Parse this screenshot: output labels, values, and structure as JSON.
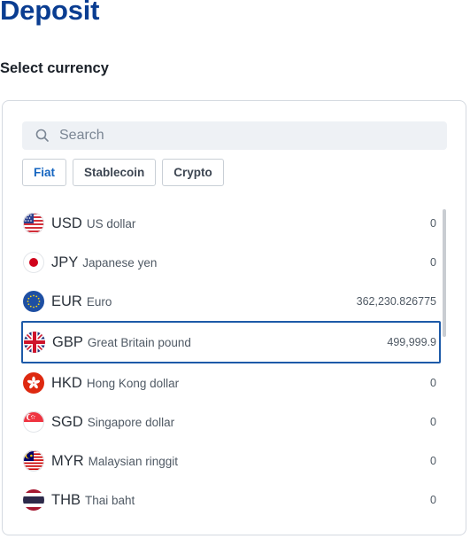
{
  "page": {
    "title": "Deposit",
    "subtitle": "Select currency"
  },
  "search": {
    "placeholder": "Search",
    "value": "",
    "icon": "search-icon"
  },
  "tabs": [
    {
      "label": "Fiat",
      "active": true
    },
    {
      "label": "Stablecoin",
      "active": false
    },
    {
      "label": "Crypto",
      "active": false
    }
  ],
  "currencies": [
    {
      "code": "USD",
      "name": "US dollar",
      "balance": "0",
      "flag": "us-flag-icon"
    },
    {
      "code": "JPY",
      "name": "Japanese yen",
      "balance": "0",
      "flag": "jp-flag-icon"
    },
    {
      "code": "EUR",
      "name": "Euro",
      "balance": "362,230.826775",
      "flag": "eu-flag-icon"
    },
    {
      "code": "GBP",
      "name": "Great Britain pound",
      "balance": "499,999.9",
      "flag": "gb-flag-icon",
      "selected": true
    },
    {
      "code": "HKD",
      "name": "Hong Kong dollar",
      "balance": "0",
      "flag": "hk-flag-icon"
    },
    {
      "code": "SGD",
      "name": "Singapore dollar",
      "balance": "0",
      "flag": "sg-flag-icon"
    },
    {
      "code": "MYR",
      "name": "Malaysian ringgit",
      "balance": "0",
      "flag": "my-flag-icon"
    },
    {
      "code": "THB",
      "name": "Thai baht",
      "balance": "0",
      "flag": "th-flag-icon"
    }
  ],
  "colors": {
    "title": "#0a3d91",
    "accent": "#1565c0",
    "selected_border": "#1d5aa8"
  }
}
